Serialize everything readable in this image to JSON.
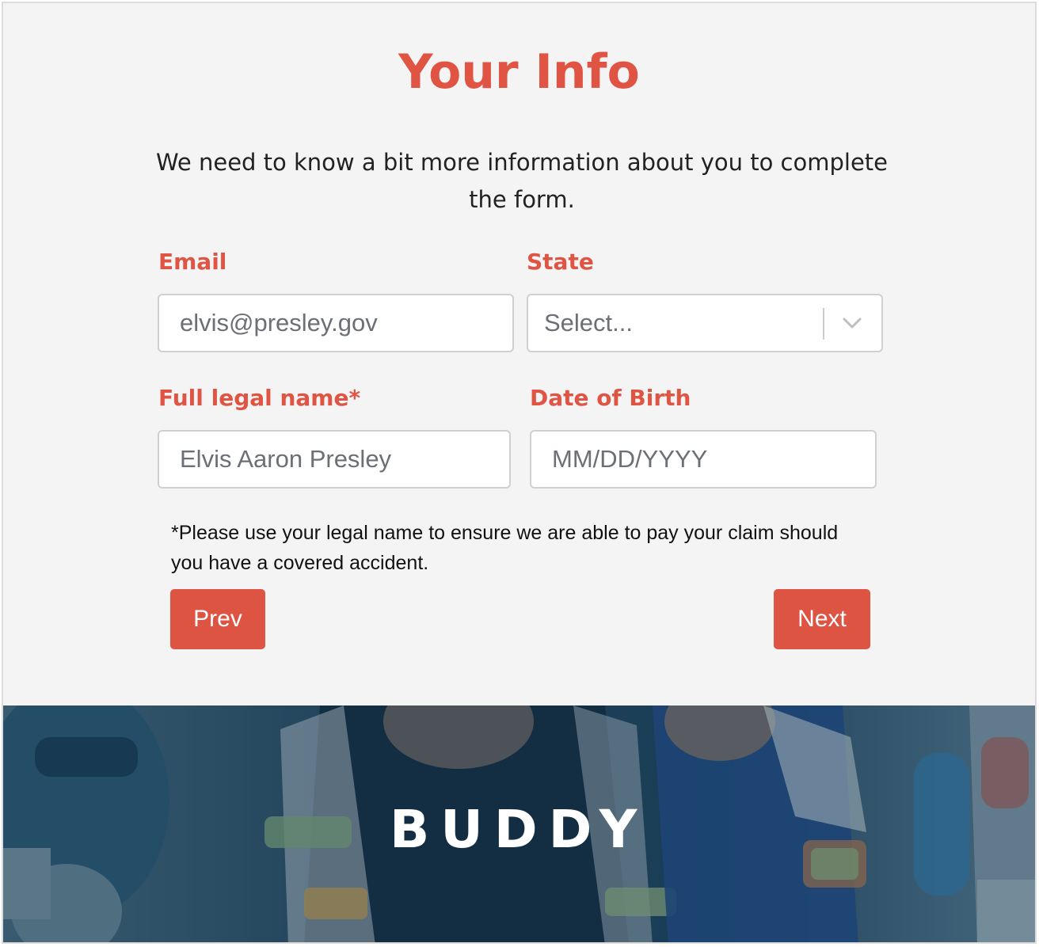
{
  "page": {
    "title": "Your Info",
    "intro": "We need to know a bit more information about you to complete the form."
  },
  "form": {
    "email": {
      "label": "Email",
      "value": "elvis@presley.gov"
    },
    "state": {
      "label": "State",
      "selected": "Select..."
    },
    "full_name": {
      "label": "Full legal name*",
      "value": "Elvis Aaron Presley"
    },
    "dob": {
      "label": "Date of Birth",
      "placeholder": "MM/DD/YYYY"
    },
    "note": "*Please use your legal name to ensure we are able to pay your claim should you have a covered accident."
  },
  "buttons": {
    "prev": "Prev",
    "next": "Next"
  },
  "footer": {
    "logo_text": "BUDDY",
    "image_subject": "cyclists-racing-photo"
  },
  "colors": {
    "accent": "#e05444",
    "button": "#de5443",
    "hero_tint": "#1f4660"
  },
  "icons": {
    "select_arrow": "chevron-down-icon"
  }
}
